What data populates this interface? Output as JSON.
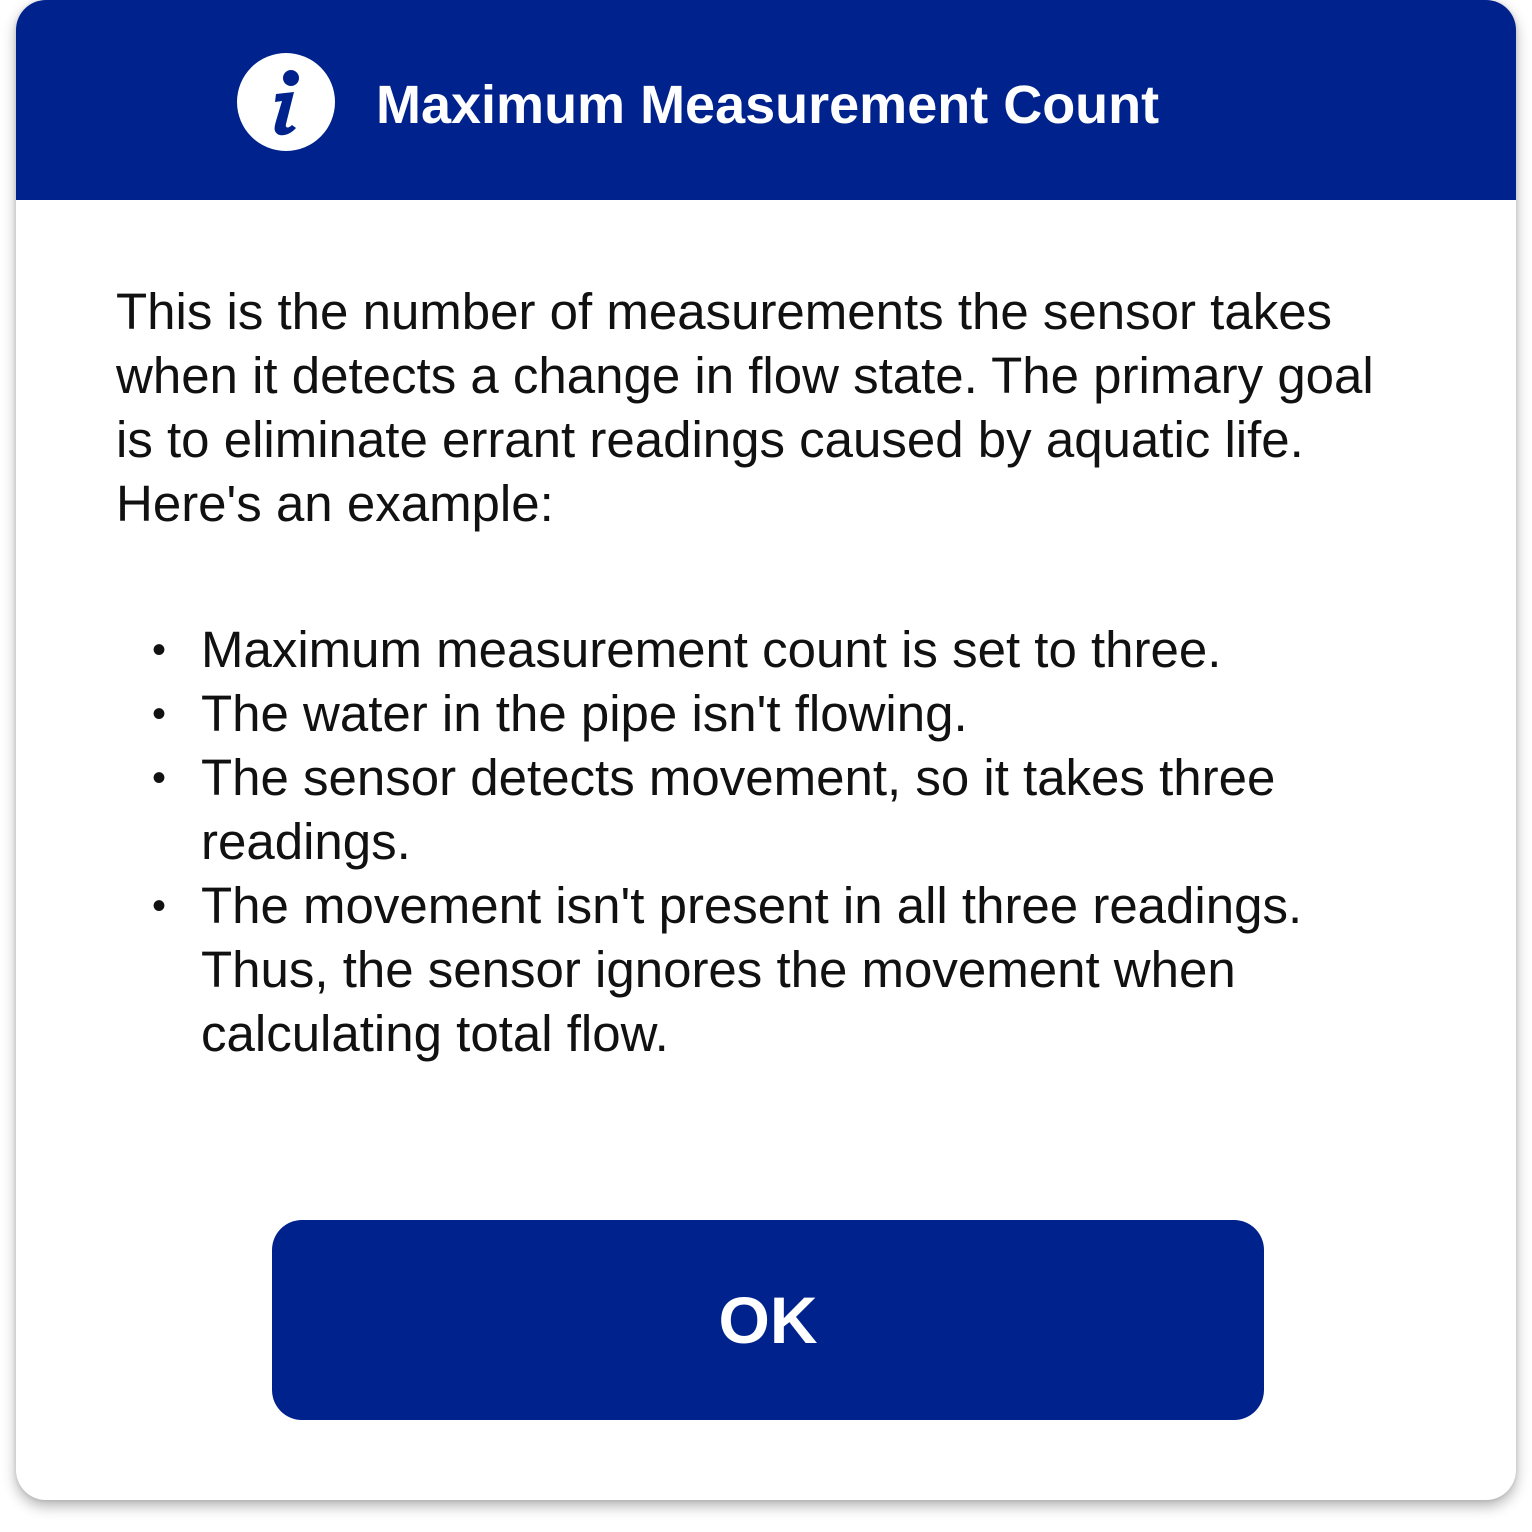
{
  "colors": {
    "primary": "#00228c",
    "background": "#ffffff",
    "text": "#111111"
  },
  "dialog": {
    "title": "Maximum Measurement Count",
    "icon": "info-icon",
    "description": "This is the number of measurements the sensor takes when it detects a change in flow state. The primary goal is to eliminate errant readings caused by aquatic life. Here's an example:",
    "bullets": [
      "Maximum measurement count is set to three.",
      "The water in the pipe isn't flowing.",
      "The sensor detects movement, so it takes three readings.",
      "The movement isn't present in all three readings. Thus, the sensor ignores the movement when calculating total flow."
    ],
    "bullet_symbol": "•",
    "ok_label": "OK"
  }
}
